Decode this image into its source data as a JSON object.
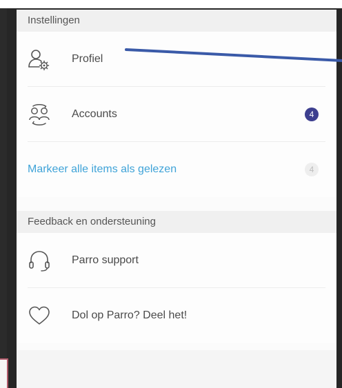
{
  "settings": {
    "header": "Instellingen",
    "items": [
      {
        "label": "Profiel",
        "icon": "profile-settings-icon"
      },
      {
        "label": "Accounts",
        "icon": "accounts-icon",
        "badge": "4"
      }
    ],
    "mark_all_read": {
      "label": "Markeer alle items als gelezen",
      "badge": "4"
    }
  },
  "feedback": {
    "header": "Feedback en ondersteuning",
    "items": [
      {
        "label": "Parro support",
        "icon": "headset-icon"
      },
      {
        "label": "Dol op Parro? Deel het!",
        "icon": "heart-icon"
      }
    ]
  },
  "colors": {
    "link": "#3fa3d8",
    "badge_active": "#3d3f8f",
    "annotation_arrow": "#3a5aa8"
  }
}
